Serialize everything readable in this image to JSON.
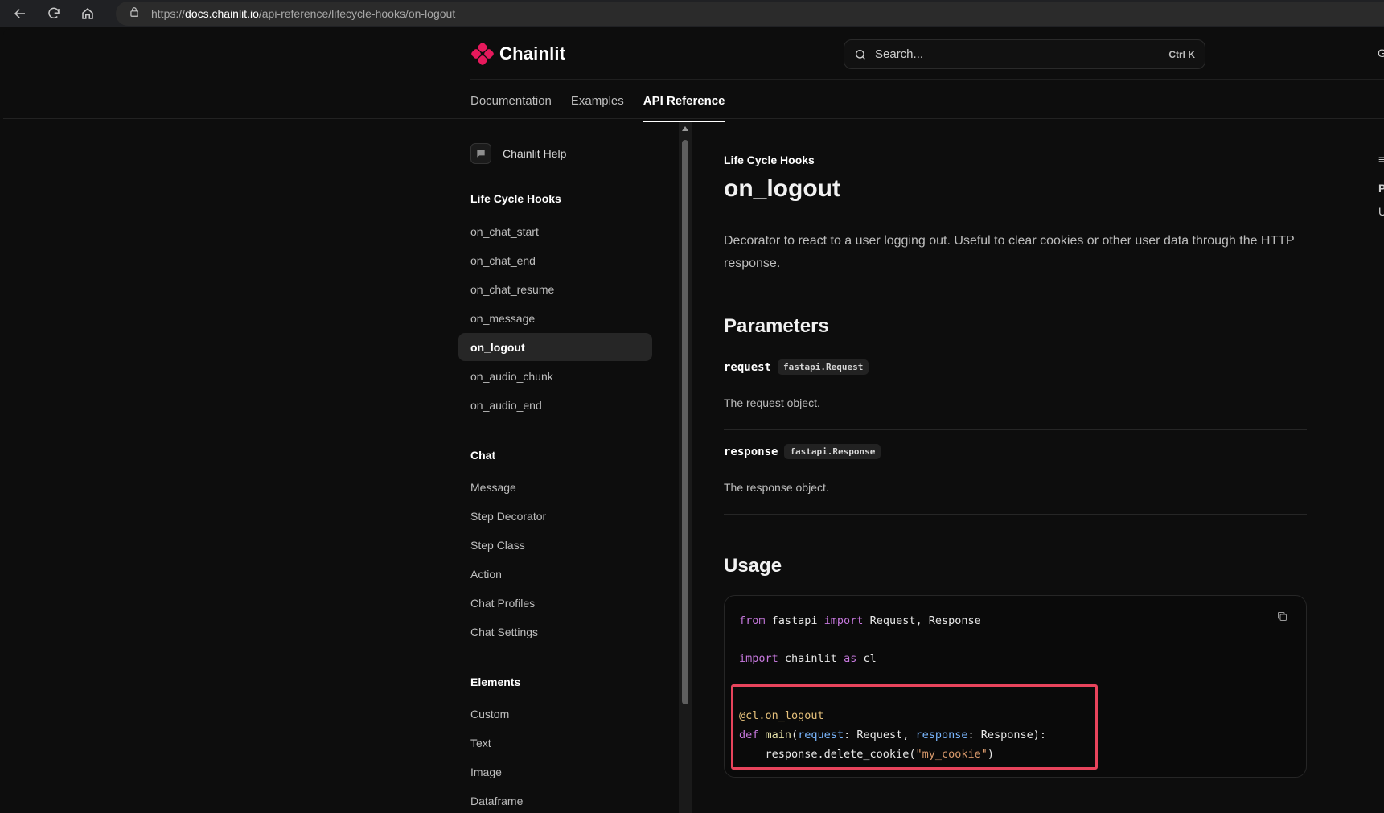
{
  "browser": {
    "url_prefix": "https://",
    "url_host": "docs.chainlit.io",
    "url_path": "/api-reference/lifecycle-hooks/on-logout"
  },
  "header": {
    "brand": "Chainlit",
    "brand_color": "#e6195c",
    "search_placeholder": "Search...",
    "search_shortcut": "Ctrl K",
    "edge_text": "G"
  },
  "tabs": [
    {
      "label": "Documentation",
      "active": false
    },
    {
      "label": "Examples",
      "active": false
    },
    {
      "label": "API Reference",
      "active": true
    }
  ],
  "sidebar": {
    "help_label": "Chainlit Help",
    "sections": [
      {
        "title": "Life Cycle Hooks",
        "items": [
          "on_chat_start",
          "on_chat_end",
          "on_chat_resume",
          "on_message",
          "on_logout",
          "on_audio_chunk",
          "on_audio_end"
        ],
        "active": "on_logout"
      },
      {
        "title": "Chat",
        "items": [
          "Message",
          "Step Decorator",
          "Step Class",
          "Action",
          "Chat Profiles",
          "Chat Settings"
        ]
      },
      {
        "title": "Elements",
        "items": [
          "Custom",
          "Text",
          "Image",
          "Dataframe"
        ]
      }
    ]
  },
  "content": {
    "breadcrumb": "Life Cycle Hooks",
    "title": "on_logout",
    "description": "Decorator to react to a user logging out. Useful to clear cookies or other user data through the HTTP response.",
    "parameters_heading": "Parameters",
    "params": [
      {
        "name": "request",
        "type": "fastapi.Request",
        "desc": "The request object."
      },
      {
        "name": "response",
        "type": "fastapi.Response",
        "desc": "The response object."
      }
    ],
    "usage_heading": "Usage",
    "code": {
      "l1_kw1": "from",
      "l1_mod": " fastapi ",
      "l1_kw2": "import",
      "l1_rest": " Request, Response",
      "l2_kw1": "import",
      "l2_mod": " chainlit ",
      "l2_kw2": "as",
      "l2_rest": " cl",
      "l3_dec": "@cl.on_logout",
      "l4_kw": "def",
      "l4_fn": " main",
      "l4_p1": "(",
      "l4_a1": "request",
      "l4_p2": ": Request, ",
      "l4_a2": "response",
      "l4_p3": ": Response):",
      "l5_pre": "    response.delete_cookie(",
      "l5_str": "\"my_cookie\"",
      "l5_post": ")"
    }
  },
  "right_edge": {
    "a": "≡",
    "b": "P",
    "c": "U"
  }
}
